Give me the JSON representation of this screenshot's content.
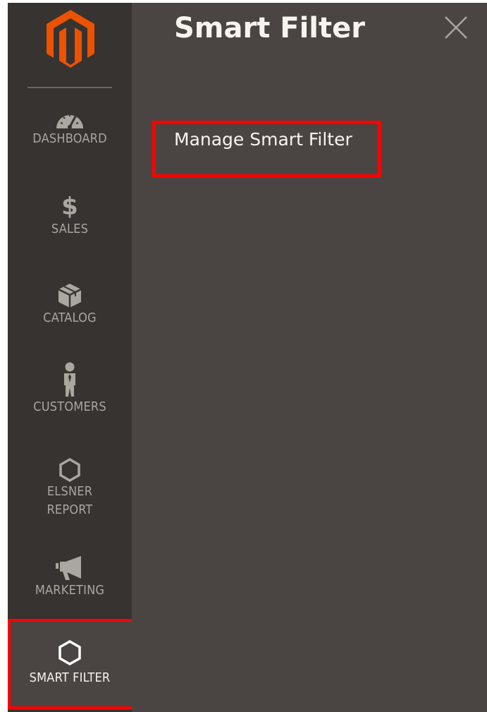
{
  "brand": {
    "logo_icon": "magento-logo-icon",
    "accent": "#eb5202"
  },
  "sidebar": {
    "items": [
      {
        "label": "DASHBOARD",
        "icon": "speedometer-icon"
      },
      {
        "label": "SALES",
        "icon": "dollar-icon",
        "glyph": "$"
      },
      {
        "label": "CATALOG",
        "icon": "box-icon"
      },
      {
        "label": "CUSTOMERS",
        "icon": "person-icon"
      },
      {
        "label_line1": "ELSNER",
        "label_line2": "REPORT",
        "icon": "hexagon-icon"
      },
      {
        "label": "MARKETING",
        "icon": "megaphone-icon"
      },
      {
        "label": "SMART FILTER",
        "icon": "hexagon-icon",
        "active": true
      }
    ]
  },
  "panel": {
    "title": "Smart Filter",
    "close_icon": "close-icon",
    "links": [
      {
        "label": "Manage Smart Filter"
      }
    ]
  },
  "colors": {
    "sidebar_bg": "#373330",
    "panel_bg": "#4a4542",
    "highlight": "#ff0000"
  }
}
